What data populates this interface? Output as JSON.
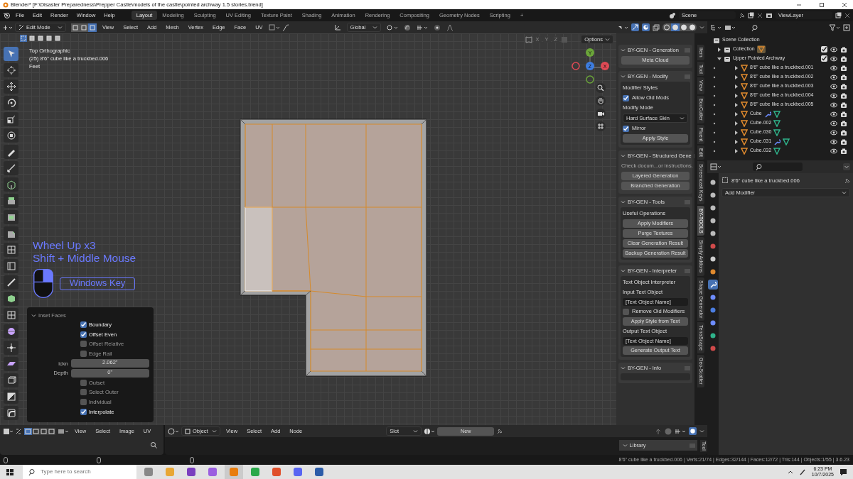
{
  "window": {
    "title": "Blender* [F:\\Disaster Preparedness\\Prepper Castle\\models of the castle\\pointed archway 1.5 stories.blend]"
  },
  "menu": [
    "File",
    "Edit",
    "Render",
    "Window",
    "Help"
  ],
  "workspaces": [
    {
      "label": "Layout",
      "selected": true
    },
    {
      "label": "Modeling",
      "selected": false
    },
    {
      "label": "Sculpting",
      "selected": false
    },
    {
      "label": "UV Editing",
      "selected": false
    },
    {
      "label": "Texture Paint",
      "selected": false
    },
    {
      "label": "Shading",
      "selected": false
    },
    {
      "label": "Animation",
      "selected": false
    },
    {
      "label": "Rendering",
      "selected": false
    },
    {
      "label": "Compositing",
      "selected": false
    },
    {
      "label": "Geometry Nodes",
      "selected": false
    },
    {
      "label": "Scripting",
      "selected": false
    }
  ],
  "add_workspace": "+",
  "scene": "Scene",
  "view_layer": "ViewLayer",
  "viewport": {
    "mode": "Edit Mode",
    "select_modes": [
      {
        "selected": false
      },
      {
        "selected": false
      },
      {
        "selected": true
      }
    ],
    "menus": [
      "View",
      "Select",
      "Add",
      "Mesh",
      "Vertex",
      "Edge",
      "Face",
      "UV"
    ],
    "orientation": "Global",
    "mirror_axes": [
      "X",
      "Y",
      "Z"
    ],
    "options": "Options",
    "info": [
      "Top Orthographic",
      "(25) 8'6\" cube like a truckbed.006",
      "Feet"
    ],
    "gizmo_axes": [
      "Y",
      "Z",
      "X"
    ],
    "tools": [
      {
        "selected": true
      },
      {
        "selected": false
      },
      {
        "selected": false
      },
      {
        "selected": false
      },
      {
        "selected": false
      },
      {
        "selected": false
      },
      {
        "selected": false
      },
      {
        "selected": false
      },
      {
        "selected": false
      },
      {
        "selected": false
      },
      {
        "selected": false
      },
      {
        "selected": false
      },
      {
        "selected": false
      },
      {
        "selected": false
      },
      {
        "selected": false
      },
      {
        "selected": false
      },
      {
        "selected": false
      },
      {
        "selected": false
      },
      {
        "selected": false
      },
      {
        "selected": false
      },
      {
        "selected": false
      },
      {
        "selected": false
      },
      {
        "selected": false
      }
    ]
  },
  "inset_panel": {
    "title": "Inset Faces",
    "options_top": [
      {
        "label": "Boundary",
        "checked": true
      },
      {
        "label": "Offset Even",
        "checked": true
      },
      {
        "label": "Offset Relative",
        "checked": false
      },
      {
        "label": "Edge Rail",
        "checked": false
      }
    ],
    "fields": [
      {
        "label": "ickn",
        "value": "2.062\""
      },
      {
        "label": "Depth",
        "value": "0\""
      }
    ],
    "options_bottom": [
      {
        "label": "Outset",
        "checked": false
      },
      {
        "label": "Select Outer",
        "checked": false
      },
      {
        "label": "Individual",
        "checked": false
      },
      {
        "label": "Interpolate",
        "checked": true
      }
    ]
  },
  "screencast": {
    "lines": [
      "Wheel Up x3",
      "Shift + Middle Mouse"
    ],
    "key": "Windows Key"
  },
  "npanel": {
    "sections": [
      {
        "title": "BY-GEN - Generation",
        "boxed": false,
        "items": [
          {
            "kind": "button",
            "label": "Meta Cloud"
          }
        ]
      },
      {
        "title": "BY-GEN - Modify",
        "boxed": true,
        "items": [
          {
            "kind": "label",
            "label": "Modifier Styles"
          },
          {
            "kind": "checkbox",
            "label": "Allow Old Mods",
            "checked": true
          },
          {
            "kind": "label",
            "label": "Modify Mode"
          },
          {
            "kind": "dropdown",
            "value": "Hard Surface Skin"
          },
          {
            "kind": "checkbox",
            "label": "Mirror",
            "checked": true
          },
          {
            "kind": "button",
            "label": "Apply Style"
          }
        ]
      },
      {
        "title": "BY-GEN - Structured Gene",
        "boxed": false,
        "items": [
          {
            "kind": "note",
            "label": "Check docum...or instructions."
          },
          {
            "kind": "button",
            "label": "Layered Generation"
          },
          {
            "kind": "button",
            "label": "Branched Generation"
          }
        ]
      },
      {
        "title": "BY-GEN - Tools",
        "boxed": true,
        "items": [
          {
            "kind": "label",
            "label": "Useful Operations"
          },
          {
            "kind": "button",
            "label": "Apply Modifiers"
          },
          {
            "kind": "button",
            "label": "Purge Textures"
          },
          {
            "kind": "button",
            "label": "Clear Generation Result"
          },
          {
            "kind": "button",
            "label": "Backup Generation Result"
          }
        ]
      },
      {
        "title": "BY-GEN - Interpreter",
        "boxed": true,
        "items": [
          {
            "kind": "label",
            "label": "Text Object Interpreter"
          },
          {
            "kind": "label",
            "label": "Input Text Object"
          },
          {
            "kind": "field",
            "value": "[Text Object Name]"
          },
          {
            "kind": "checkbox",
            "label": "Remove Old Modifiers",
            "checked": false
          },
          {
            "kind": "button",
            "label": "Apply Style from Text"
          },
          {
            "kind": "label",
            "label": "Output Text Object"
          },
          {
            "kind": "field",
            "value": "[Text Object Name]"
          },
          {
            "kind": "button",
            "label": "Generate Output Text"
          }
        ]
      },
      {
        "title": "BY-GEN - Info",
        "boxed": true
      }
    ]
  },
  "ntabs": [
    {
      "label": "Item",
      "selected": false
    },
    {
      "label": "Tool",
      "selected": false
    },
    {
      "label": "View",
      "selected": false
    },
    {
      "label": "BoxCutter",
      "selected": false
    },
    {
      "label": "Fluent",
      "selected": false
    },
    {
      "label": "Edit",
      "selected": false
    },
    {
      "label": "Screencast Keys",
      "selected": false
    },
    {
      "label": "BY-TOOLS",
      "selected": true
    },
    {
      "label": "Simply Addons",
      "selected": false
    },
    {
      "label": "Shape Generator",
      "selected": false
    },
    {
      "label": "TerraScape",
      "selected": false
    },
    {
      "label": "Geo-Scatter",
      "selected": false
    }
  ],
  "outliner": {
    "root": "Scene Collection",
    "children": [
      {
        "name": "Collection",
        "expanded": false,
        "checked": true
      },
      {
        "name": "Upper Pointed Archway",
        "expanded": true,
        "checked": true,
        "children": [
          {
            "name": "8'6\" cube like a truckbed.001",
            "modifier": false,
            "mesh": false
          },
          {
            "name": "8'6\" cube like a truckbed.002",
            "modifier": false,
            "mesh": false
          },
          {
            "name": "8'6\" cube like a truckbed.003",
            "modifier": false,
            "mesh": false
          },
          {
            "name": "8'6\" cube like a truckbed.004",
            "modifier": false,
            "mesh": false
          },
          {
            "name": "8'6\" cube like a truckbed.005",
            "modifier": false,
            "mesh": false
          },
          {
            "name": "Cube",
            "modifier": true,
            "mesh": true
          },
          {
            "name": "Cube.002",
            "modifier": false,
            "mesh": true
          },
          {
            "name": "Cube.030",
            "modifier": false,
            "mesh": true
          },
          {
            "name": "Cube.031",
            "modifier": true,
            "mesh": true
          },
          {
            "name": "Cube.032",
            "modifier": false,
            "mesh": true
          }
        ]
      }
    ]
  },
  "properties": {
    "object": "8'6\" cube like a truckbed.006",
    "add_modifier": "Add Modifier",
    "tabs": [
      {
        "selected": false
      },
      {
        "selected": false
      },
      {
        "selected": false
      },
      {
        "selected": false
      },
      {
        "selected": false
      },
      {
        "selected": false
      },
      {
        "selected": false
      },
      {
        "selected": false
      },
      {
        "selected": true
      },
      {
        "selected": false
      },
      {
        "selected": false
      },
      {
        "selected": false
      },
      {
        "selected": false
      },
      {
        "selected": false
      }
    ]
  },
  "image_editor": {
    "menus": [
      "View",
      "Select",
      "Image",
      "UV"
    ]
  },
  "node_editor": {
    "data": "Object",
    "menus": [
      "View",
      "Select",
      "Add",
      "Node"
    ],
    "slot": "Slot",
    "new": "New",
    "library": "Library",
    "tool_tab": "Tool"
  },
  "status_bar": "8'6\" cube like a truckbed.006 | Verts:21/74 | Edges:32/144 | Faces:12/72 | Tris:144 | Objects:1/55 | 3.6.23",
  "taskbar": {
    "search": {
      "placeholder": "Type here to search"
    },
    "apps": [
      {
        "selected": false
      },
      {
        "selected": false
      },
      {
        "selected": false
      },
      {
        "selected": false
      },
      {
        "selected": true
      },
      {
        "selected": false
      },
      {
        "selected": false
      },
      {
        "selected": false
      },
      {
        "selected": false
      }
    ],
    "time": "6:23 PM",
    "date": "10/7/2025"
  }
}
